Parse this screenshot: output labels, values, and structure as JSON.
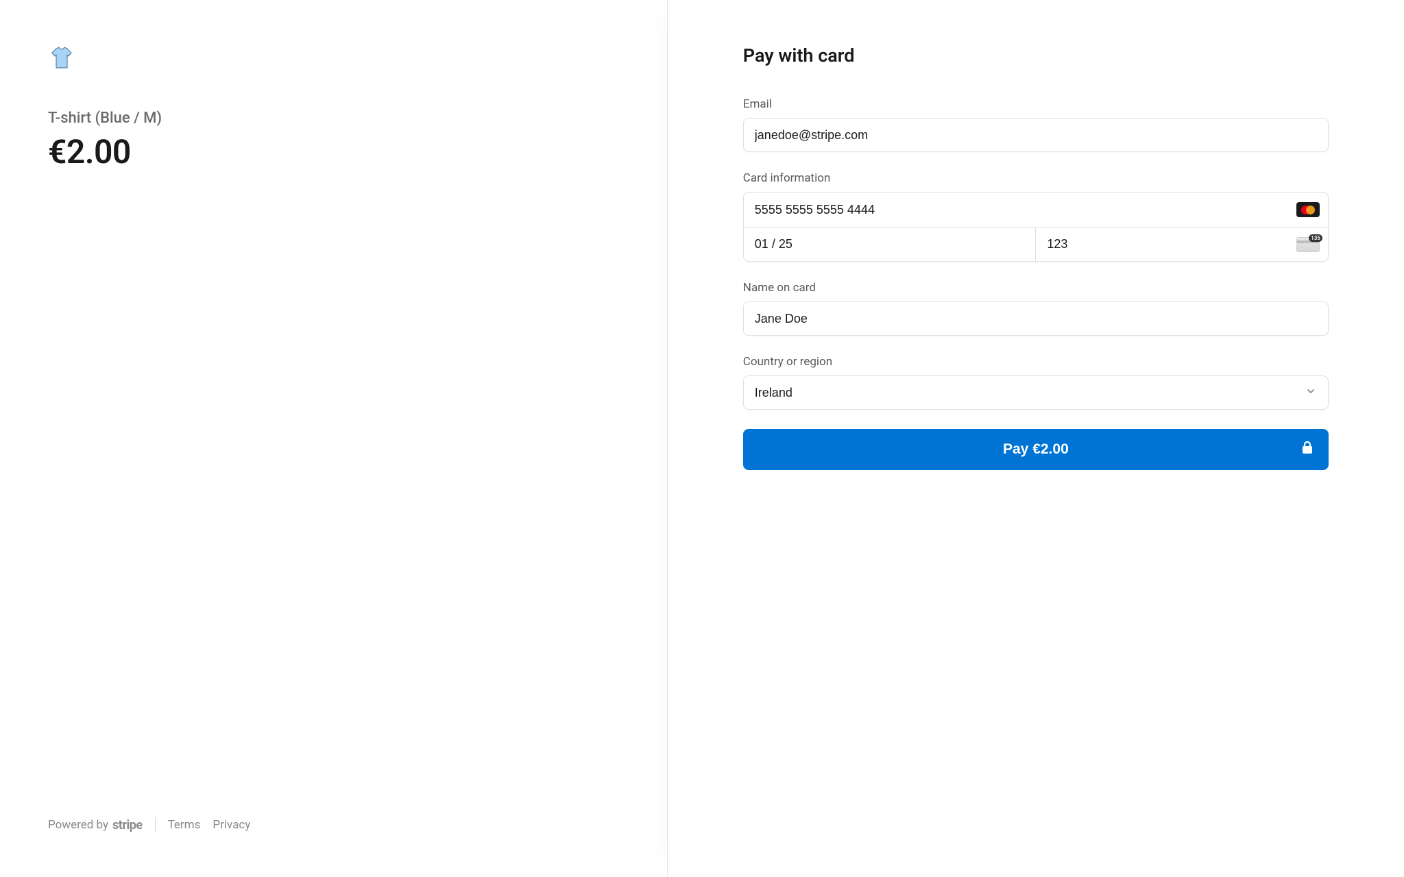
{
  "product": {
    "icon_name": "tshirt-icon",
    "name": "T-shirt (Blue / M)",
    "price": "€2.00"
  },
  "footer": {
    "powered_by": "Powered by",
    "brand": "stripe",
    "terms": "Terms",
    "privacy": "Privacy"
  },
  "form": {
    "heading": "Pay with card",
    "email_label": "Email",
    "email_value": "janedoe@stripe.com",
    "card_label": "Card information",
    "card_number": "5555 5555 5555 4444",
    "card_expiry": "01 / 25",
    "card_cvc": "123",
    "cvc_badge": "135",
    "name_label": "Name on card",
    "name_value": "Jane Doe",
    "country_label": "Country or region",
    "country_value": "Ireland",
    "pay_button": "Pay €2.00"
  },
  "colors": {
    "accent": "#0074d4"
  }
}
